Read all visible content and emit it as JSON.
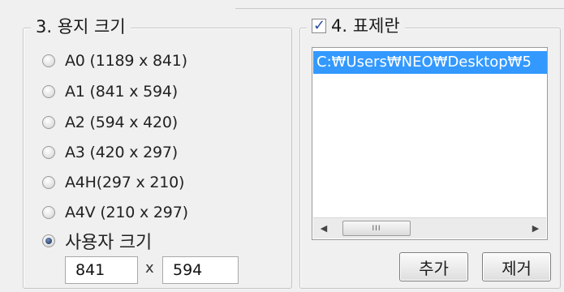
{
  "paper_size": {
    "legend": "3. 용지 크기",
    "options": [
      {
        "label": "A0 (1189 x 841)",
        "checked": false
      },
      {
        "label": "A1 (841 x 594)",
        "checked": false
      },
      {
        "label": "A2 (594 x 420)",
        "checked": false
      },
      {
        "label": "A3 (420 x 297)",
        "checked": false
      },
      {
        "label": "A4H(297 x 210)",
        "checked": false
      },
      {
        "label": "A4V (210 x 297)",
        "checked": false
      },
      {
        "label": "사용자 크기",
        "checked": true
      }
    ],
    "custom_width": "841",
    "separator": "x",
    "custom_height": "594"
  },
  "title_block": {
    "legend": "4. 표제란",
    "enabled": true,
    "items": [
      "C:₩Users₩NEO₩Desktop₩5"
    ],
    "scroll_thumb_glyph": "III",
    "add_label": "추가",
    "remove_label": "제거"
  },
  "colors": {
    "selection": "#3399ff",
    "background": "#f0f0f0"
  }
}
